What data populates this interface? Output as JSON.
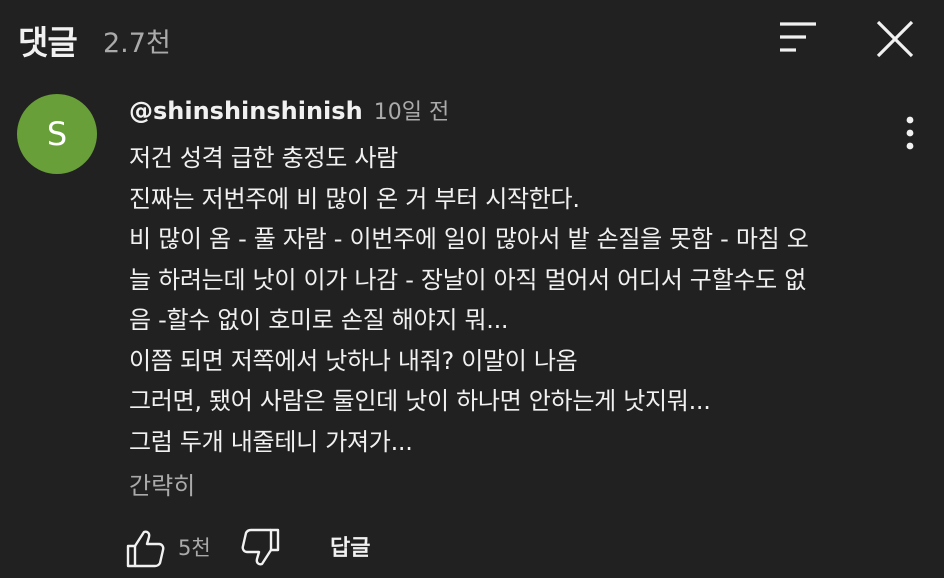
{
  "header": {
    "title": "댓글",
    "count": "2.7천"
  },
  "comment": {
    "avatar_letter": "S",
    "avatar_color": "#689f38",
    "author": "@shinshinshinish",
    "time": "10일 전",
    "text": "저건 성격 급한 충정도 사람\n진짜는 저번주에 비 많이 온 거 부터 시작한다.\n비 많이 옴 - 풀 자람 - 이번주에 일이 많아서 밭 손질을 못함 - 마침 오\n늘 하려는데 낫이 이가 나감 - 장날이 아직 멀어서 어디서 구할수도 없\n음 -할수 없이 호미로 손질 해야지 뭐...\n이쯤 되면 저쪽에서 낫하나 내줘? 이말이 나옴\n그러면, 됐어 사람은 둘인데 낫이 하나면 안하는게 낫지뭐...\n그럼 두개 내줄테니 가져가...",
    "collapse_label": "간략히",
    "like_count": "5천",
    "reply_label": "답글"
  },
  "icons": {
    "sort": "sort-icon",
    "close": "close-icon",
    "more": "more-vert-icon",
    "like": "thumb-up-icon",
    "dislike": "thumb-down-icon"
  },
  "colors": {
    "background": "#212121",
    "text_primary": "#f1f1f1",
    "text_secondary": "#aaaaaa"
  }
}
